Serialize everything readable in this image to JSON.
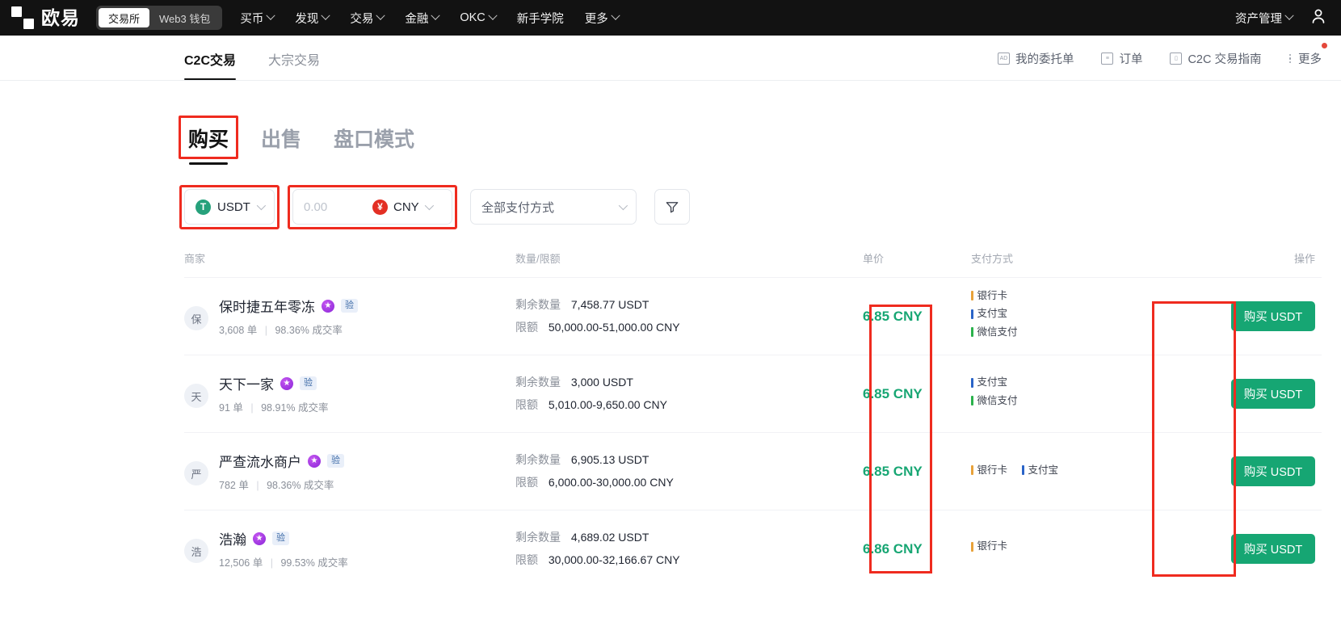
{
  "topnav": {
    "brand": "欧易",
    "segments": [
      {
        "label": "交易所",
        "active": true
      },
      {
        "label": "Web3 钱包",
        "active": false
      }
    ],
    "links": [
      {
        "label": "买币",
        "caret": true
      },
      {
        "label": "发现",
        "caret": true
      },
      {
        "label": "交易",
        "caret": true
      },
      {
        "label": "金融",
        "caret": true
      },
      {
        "label": "OKC",
        "caret": true
      },
      {
        "label": "新手学院",
        "caret": false
      },
      {
        "label": "更多",
        "caret": true
      }
    ],
    "right": {
      "assets_label": "资产管理",
      "account_icon": "user-icon"
    }
  },
  "subbar": {
    "tabs": [
      {
        "label": "C2C交易",
        "active": true
      },
      {
        "label": "大宗交易",
        "active": false
      }
    ],
    "links": [
      {
        "label": "我的委托单",
        "icon": "ad-icon",
        "glyph": "AD",
        "dot": false
      },
      {
        "label": "订单",
        "icon": "document-icon",
        "glyph": "≡",
        "dot": false
      },
      {
        "label": "C2C 交易指南",
        "icon": "book-icon",
        "glyph": "▯",
        "dot": false
      },
      {
        "label": "更多",
        "icon": "more-vertical-icon",
        "glyph": "",
        "dot": true
      }
    ]
  },
  "main": {
    "tabs": [
      {
        "label": "购买",
        "active": true,
        "highlighted": true
      },
      {
        "label": "出售",
        "active": false,
        "highlighted": false
      },
      {
        "label": "盘口模式",
        "active": false,
        "highlighted": false
      }
    ],
    "filters": {
      "coin": {
        "label": "USDT",
        "symbol": "T",
        "color": "#26a17b"
      },
      "amount": {
        "value": "",
        "placeholder": "0.00",
        "currency": "CNY",
        "currency_symbol": "¥",
        "currency_color": "#e32f24"
      },
      "payment": {
        "label": "全部支付方式"
      },
      "filter_button": {
        "icon": "funnel-icon"
      }
    },
    "table": {
      "headers": {
        "merchant": "商家",
        "amount": "数量/限额",
        "price": "单价",
        "payment": "支付方式",
        "action": "操作"
      },
      "labels": {
        "available": "剩余数量",
        "limit": "限额",
        "verified_badge": "验",
        "orders_suffix": "单",
        "rate_suffix": "成交率"
      },
      "rows": [
        {
          "avatar": "保",
          "name": "保时捷五年零冻",
          "orders": "3,608 单",
          "rate": "98.36% 成交率",
          "available": "7,458.77 USDT",
          "limit": "50,000.00-51,000.00 CNY",
          "price": "6.85 CNY",
          "payments": [
            {
              "name": "银行卡",
              "color": "#e8a23a"
            },
            {
              "name": "支付宝",
              "color": "#2a64c8"
            },
            {
              "name": "微信支付",
              "color": "#2bb24c"
            }
          ],
          "payment_layout": "stacked",
          "action": "购买 USDT"
        },
        {
          "avatar": "天",
          "name": "天下一家",
          "orders": "91 单",
          "rate": "98.91% 成交率",
          "available": "3,000 USDT",
          "limit": "5,010.00-9,650.00 CNY",
          "price": "6.85 CNY",
          "payments": [
            {
              "name": "支付宝",
              "color": "#2a64c8"
            },
            {
              "name": "微信支付",
              "color": "#2bb24c"
            }
          ],
          "payment_layout": "stacked",
          "action": "购买 USDT"
        },
        {
          "avatar": "严",
          "name": "严查流水商户",
          "orders": "782 单",
          "rate": "98.36% 成交率",
          "available": "6,905.13 USDT",
          "limit": "6,000.00-30,000.00 CNY",
          "price": "6.85 CNY",
          "payments": [
            {
              "name": "银行卡",
              "color": "#e8a23a"
            },
            {
              "name": "支付宝",
              "color": "#2a64c8"
            }
          ],
          "payment_layout": "inline",
          "action": "购买 USDT"
        },
        {
          "avatar": "浩",
          "name": "浩瀚",
          "orders": "12,506 单",
          "rate": "99.53% 成交率",
          "available": "4,689.02 USDT",
          "limit": "30,000.00-32,166.67 CNY",
          "price": "6.86 CNY",
          "payments": [
            {
              "name": "银行卡",
              "color": "#e8a23a"
            }
          ],
          "payment_layout": "stacked",
          "action": "购买 USDT"
        }
      ]
    }
  },
  "colors": {
    "accent_green": "#16a673",
    "highlight_red": "#ef2b1f",
    "nav_bg": "#121212"
  }
}
